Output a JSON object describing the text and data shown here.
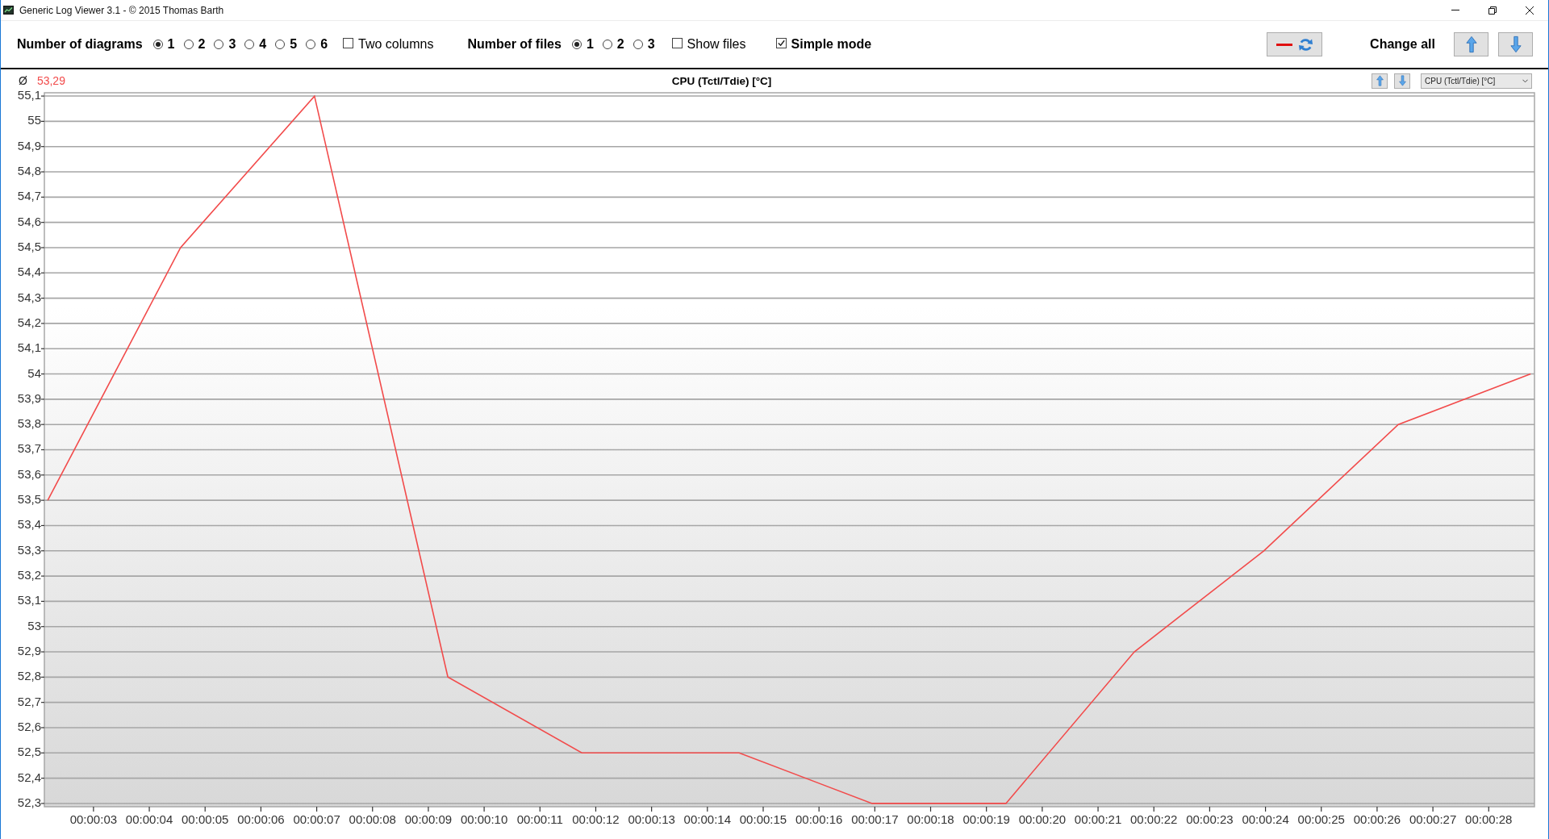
{
  "window": {
    "title": "Generic Log Viewer 3.1 - © 2015 Thomas Barth"
  },
  "toolbar": {
    "diagrams": {
      "label": "Number of diagrams",
      "options": [
        {
          "label": "1",
          "selected": true
        },
        {
          "label": "2",
          "selected": false
        },
        {
          "label": "3",
          "selected": false
        },
        {
          "label": "4",
          "selected": false
        },
        {
          "label": "5",
          "selected": false
        },
        {
          "label": "6",
          "selected": false
        }
      ]
    },
    "two_columns": {
      "label": "Two columns",
      "checked": false
    },
    "files": {
      "label": "Number of files",
      "options": [
        {
          "label": "1",
          "selected": true
        },
        {
          "label": "2",
          "selected": false
        },
        {
          "label": "3",
          "selected": false
        }
      ]
    },
    "show_files": {
      "label": "Show files",
      "checked": false
    },
    "simple_mode": {
      "label": "Simple mode",
      "checked": true
    },
    "change_all": {
      "label": "Change all"
    }
  },
  "diagram": {
    "average_symbol": "Ø",
    "average": "53,29",
    "sensor_select": {
      "value": "CPU (Tctl/Tdie) [°C]"
    },
    "chart_data": {
      "type": "line",
      "title": "CPU (Tctl/Tdie) [°C]",
      "grid": true,
      "x": [
        2.18,
        4.56,
        6.96,
        9.35,
        11.75,
        14.57,
        16.95,
        19.35,
        21.65,
        23.97,
        26.38,
        28.75
      ],
      "series": [
        {
          "color": "#f24b4b",
          "values": [
            53.5,
            54.5,
            55.1,
            52.8,
            52.5,
            52.5,
            52.3,
            52.3,
            52.9,
            53.3,
            53.8,
            54.0
          ]
        }
      ],
      "xlim": [
        2.12,
        28.82
      ],
      "ylim": [
        52.287,
        55.113
      ],
      "xticks": [
        {
          "value": 3,
          "label": "00:00:03"
        },
        {
          "value": 4,
          "label": "00:00:04"
        },
        {
          "value": 5,
          "label": "00:00:05"
        },
        {
          "value": 6,
          "label": "00:00:06"
        },
        {
          "value": 7,
          "label": "00:00:07"
        },
        {
          "value": 8,
          "label": "00:00:08"
        },
        {
          "value": 9,
          "label": "00:00:09"
        },
        {
          "value": 10,
          "label": "00:00:10"
        },
        {
          "value": 11,
          "label": "00:00:11"
        },
        {
          "value": 12,
          "label": "00:00:12"
        },
        {
          "value": 13,
          "label": "00:00:13"
        },
        {
          "value": 14,
          "label": "00:00:14"
        },
        {
          "value": 15,
          "label": "00:00:15"
        },
        {
          "value": 16,
          "label": "00:00:16"
        },
        {
          "value": 17,
          "label": "00:00:17"
        },
        {
          "value": 18,
          "label": "00:00:18"
        },
        {
          "value": 19,
          "label": "00:00:19"
        },
        {
          "value": 20,
          "label": "00:00:20"
        },
        {
          "value": 21,
          "label": "00:00:21"
        },
        {
          "value": 22,
          "label": "00:00:22"
        },
        {
          "value": 23,
          "label": "00:00:23"
        },
        {
          "value": 24,
          "label": "00:00:24"
        },
        {
          "value": 25,
          "label": "00:00:25"
        },
        {
          "value": 26,
          "label": "00:00:26"
        },
        {
          "value": 27,
          "label": "00:00:27"
        },
        {
          "value": 28,
          "label": "00:00:28"
        }
      ],
      "yticks": [
        {
          "value": 55.1,
          "label": "55,1"
        },
        {
          "value": 55,
          "label": "55"
        },
        {
          "value": 54.9,
          "label": "54,9"
        },
        {
          "value": 54.8,
          "label": "54,8"
        },
        {
          "value": 54.7,
          "label": "54,7"
        },
        {
          "value": 54.6,
          "label": "54,6"
        },
        {
          "value": 54.5,
          "label": "54,5"
        },
        {
          "value": 54.4,
          "label": "54,4"
        },
        {
          "value": 54.3,
          "label": "54,3"
        },
        {
          "value": 54.2,
          "label": "54,2"
        },
        {
          "value": 54.1,
          "label": "54,1"
        },
        {
          "value": 54,
          "label": "54"
        },
        {
          "value": 53.9,
          "label": "53,9"
        },
        {
          "value": 53.8,
          "label": "53,8"
        },
        {
          "value": 53.7,
          "label": "53,7"
        },
        {
          "value": 53.6,
          "label": "53,6"
        },
        {
          "value": 53.5,
          "label": "53,5"
        },
        {
          "value": 53.4,
          "label": "53,4"
        },
        {
          "value": 53.3,
          "label": "53,3"
        },
        {
          "value": 53.2,
          "label": "53,2"
        },
        {
          "value": 53.1,
          "label": "53,1"
        },
        {
          "value": 53,
          "label": "53"
        },
        {
          "value": 52.9,
          "label": "52,9"
        },
        {
          "value": 52.8,
          "label": "52,8"
        },
        {
          "value": 52.7,
          "label": "52,7"
        },
        {
          "value": 52.6,
          "label": "52,6"
        },
        {
          "value": 52.5,
          "label": "52,5"
        },
        {
          "value": 52.4,
          "label": "52,4"
        },
        {
          "value": 52.3,
          "label": "52,3"
        }
      ]
    }
  }
}
